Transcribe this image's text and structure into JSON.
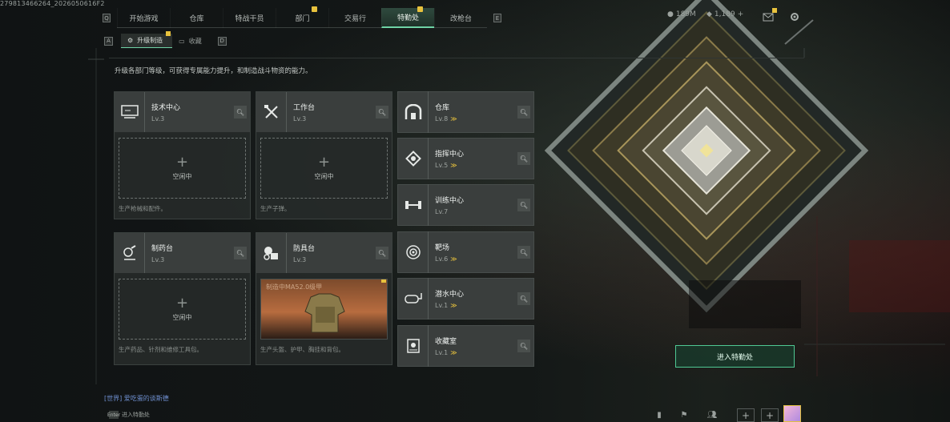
{
  "meta": {
    "session_id": "279813466264_2026050616F2"
  },
  "topnav": {
    "left_key": "Q",
    "right_key": "E",
    "tabs": [
      {
        "label": "开始游戏",
        "active": false,
        "flag": false
      },
      {
        "label": "仓库",
        "active": false,
        "flag": false
      },
      {
        "label": "特战干员",
        "active": false,
        "flag": false
      },
      {
        "label": "部门",
        "active": false,
        "flag": true
      },
      {
        "label": "交易行",
        "active": false,
        "flag": false
      },
      {
        "label": "特勤处",
        "active": true,
        "flag": true
      },
      {
        "label": "改枪台",
        "active": false,
        "flag": false
      }
    ],
    "currency1": "189M",
    "currency2": "1,189"
  },
  "subnav": {
    "left_key": "A",
    "right_key": "D",
    "tabs": [
      {
        "label": "升级制造",
        "active": true
      },
      {
        "label": "收藏",
        "active": false
      }
    ]
  },
  "description": "升级各部门等级，可获得专属能力提升，和制造战斗物资的能力。",
  "stations": [
    {
      "title": "技术中心",
      "level": "Lv.3",
      "slot_text": "空闲中",
      "desc": "生产枪械和配件。"
    },
    {
      "title": "工作台",
      "level": "Lv.3",
      "slot_text": "空闲中",
      "desc": "生产子弹。"
    },
    {
      "title": "制药台",
      "level": "Lv.3",
      "slot_text": "空闲中",
      "desc": "生产药品、针剂和维修工具包。"
    },
    {
      "title": "防具台",
      "level": "Lv.3",
      "slot_text": "制造中MA52.0级甲",
      "desc": "生产头盔、护甲、胸挂和背包。"
    }
  ],
  "facilities": [
    {
      "title": "仓库",
      "level": "Lv.8",
      "upgradable": true
    },
    {
      "title": "指挥中心",
      "level": "Lv.5",
      "upgradable": true
    },
    {
      "title": "训练中心",
      "level": "Lv.7",
      "upgradable": false
    },
    {
      "title": "靶场",
      "level": "Lv.6",
      "upgradable": true
    },
    {
      "title": "潜水中心",
      "level": "Lv.1",
      "upgradable": true
    },
    {
      "title": "收藏室",
      "level": "Lv.1",
      "upgradable": true
    }
  ],
  "enter_button": "进入特勤处",
  "chat": {
    "message": "[世界] 爱吃蛋的谈斯德",
    "button_key": "Enter",
    "button_label": "进入特勤处"
  },
  "colors": {
    "accent": "#6fd3a6",
    "flag": "#e8c23d",
    "panel": "#3a3e3d"
  }
}
